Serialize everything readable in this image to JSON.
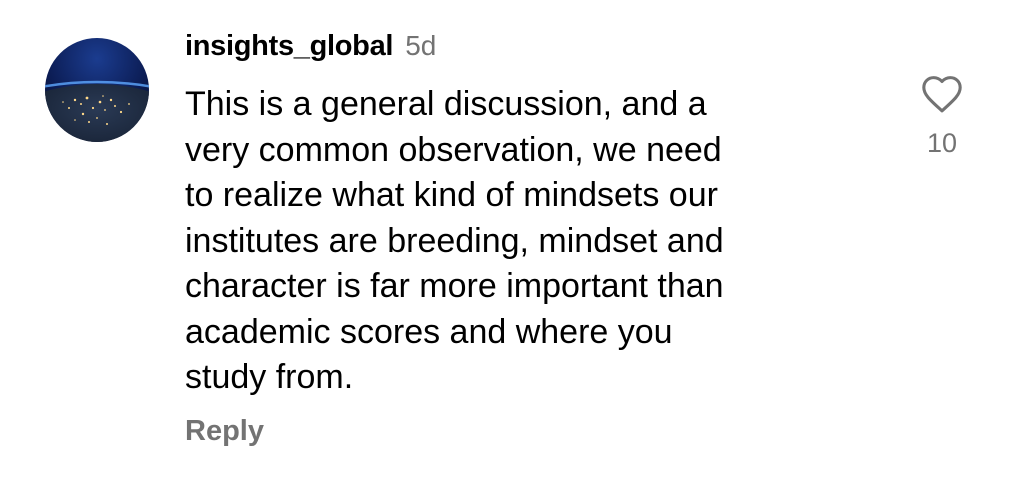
{
  "comment": {
    "avatar_icon": "earth-from-space-avatar",
    "username": "insights_global",
    "timestamp": "5d",
    "lines": [
      "This is a general discussion, and a",
      "very common observation, we need",
      "to realize what kind of mindsets our",
      "institutes are breeding, mindset and",
      "character is far more important than",
      "academic scores and where you",
      "study from."
    ],
    "reply_label": "Reply",
    "like_icon": "heart-outline-icon",
    "like_count": "10"
  },
  "colors": {
    "text": "#000000",
    "secondary": "#737373",
    "background": "#ffffff"
  }
}
